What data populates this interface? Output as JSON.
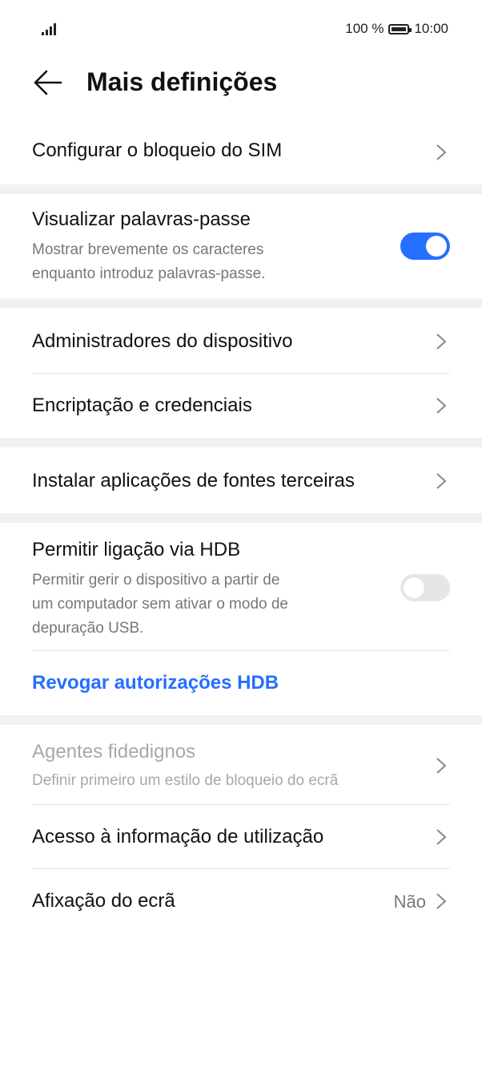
{
  "status": {
    "battery_pct": "100 %",
    "time": "10:00"
  },
  "header": {
    "title": "Mais definições"
  },
  "items": {
    "sim_lock": {
      "label": "Configurar o bloqueio do SIM"
    },
    "show_passwords": {
      "label": "Visualizar palavras-passe",
      "sub_line1": "Mostrar brevemente os caracteres",
      "sub_line2": "enquanto introduz palavras-passe.",
      "toggle": "on"
    },
    "device_admins": {
      "label": "Administradores do dispositivo"
    },
    "encryption": {
      "label": "Encriptação e credenciais"
    },
    "install_third_party": {
      "label": "Instalar aplicações de fontes terceiras"
    },
    "hdb": {
      "label": "Permitir ligação via HDB",
      "sub_line1": "Permitir gerir o dispositivo a partir de",
      "sub_line2": "um computador sem ativar o modo de",
      "sub_line3": "depuração USB.",
      "toggle": "off"
    },
    "revoke_hdb": {
      "label": "Revogar autorizações HDB"
    },
    "trust_agents": {
      "label": "Agentes fidedignos",
      "sub": "Definir primeiro um estilo de bloqueio do ecrã"
    },
    "usage_access": {
      "label": "Acesso à informação de utilização"
    },
    "screen_pinning": {
      "label": "Afixação do ecrã",
      "value": "Não"
    }
  },
  "colors": {
    "accent": "#256fff",
    "separator": "#f1f1f1",
    "secondary_text": "#777777"
  }
}
